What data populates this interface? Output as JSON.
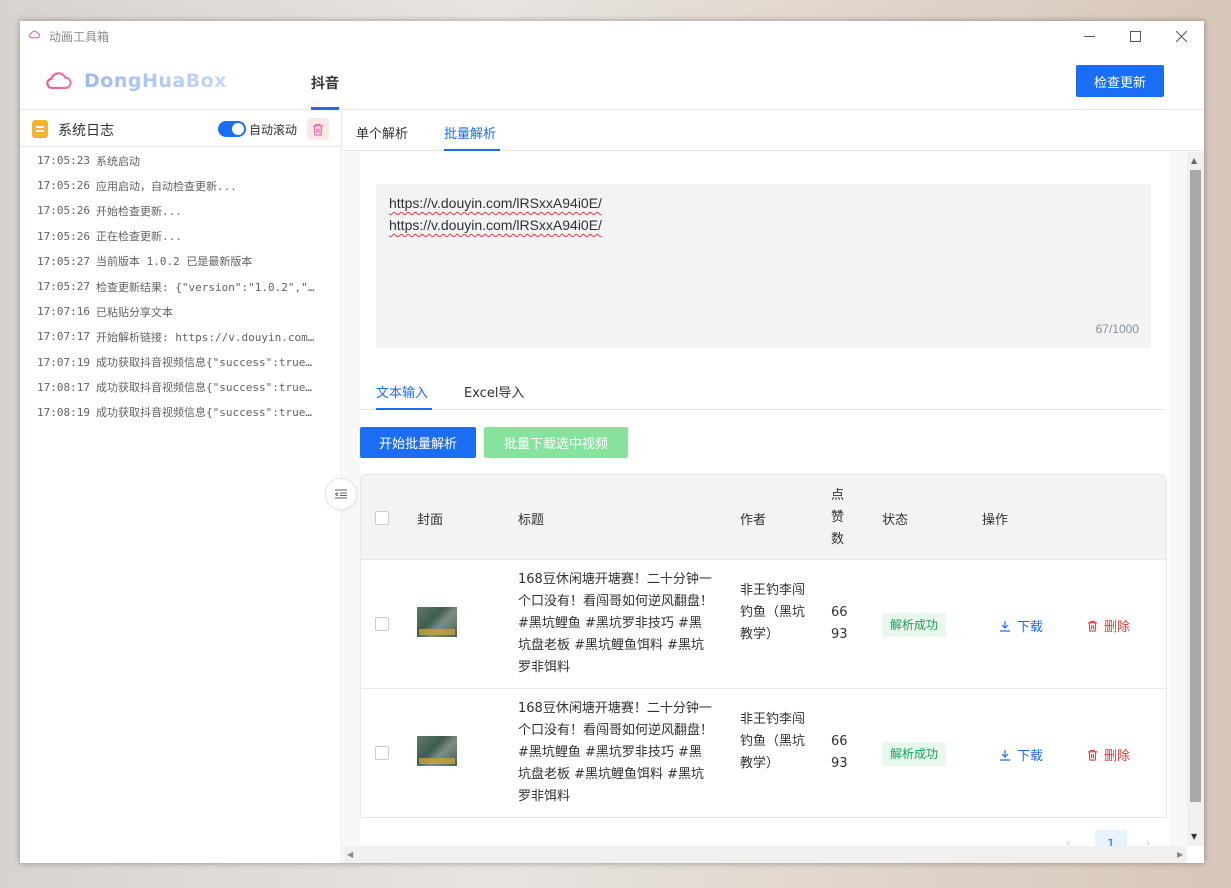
{
  "window": {
    "title": "动画工具箱"
  },
  "header": {
    "logo_text": "DongHuaBox",
    "nav_tab": "抖音",
    "update_button": "检查更新"
  },
  "sidebar": {
    "title": "系统日志",
    "auto_scroll_label": "自动滚动",
    "auto_scroll_on": true,
    "logs": [
      {
        "time": "17:05:23",
        "msg": "系统启动"
      },
      {
        "time": "17:05:26",
        "msg": "应用启动，自动检查更新..."
      },
      {
        "time": "17:05:26",
        "msg": "开始检查更新..."
      },
      {
        "time": "17:05:26",
        "msg": "正在检查更新..."
      },
      {
        "time": "17:05:27",
        "msg": "当前版本 1.0.2 已是最新版本"
      },
      {
        "time": "17:05:27",
        "msg": "检查更新结果: {\"version\":\"1.0.2\",\"f…"
      },
      {
        "time": "17:07:16",
        "msg": "已粘贴分享文本"
      },
      {
        "time": "17:07:17",
        "msg": "开始解析链接: https://v.douyin.com/…"
      },
      {
        "time": "17:07:19",
        "msg": "成功获取抖音视频信息{\"success\":true…"
      },
      {
        "time": "17:08:17",
        "msg": "成功获取抖音视频信息{\"success\":true…"
      },
      {
        "time": "17:08:19",
        "msg": "成功获取抖音视频信息{\"success\":true…"
      }
    ]
  },
  "main": {
    "tabs": [
      "单个解析",
      "批量解析"
    ],
    "active_tab": "批量解析",
    "textarea": {
      "lines": [
        "https://v.douyin.com/lRSxxA94i0E/",
        "https://v.douyin.com/lRSxxA94i0E/"
      ],
      "count": "67/1000"
    },
    "input_tabs": [
      "文本输入",
      "Excel导入"
    ],
    "start_button": "开始批量解析",
    "download_selected_button": "批量下载选中视频",
    "table": {
      "headers": {
        "cover": "封面",
        "title": "标题",
        "author": "作者",
        "likes": "点赞数",
        "status": "状态",
        "actions": "操作"
      },
      "rows": [
        {
          "title": "168豆休闲塘开塘赛！二十分钟一个口没有！看闯哥如何逆风翻盘！#黑坑鲤鱼 #黑坑罗非技巧 #黑坑盘老板 #黑坑鲤鱼饵料 #黑坑罗非饵料",
          "author": "非王钓李闯钓鱼（黑坑教学）",
          "likes": "6693",
          "status": "解析成功",
          "download": "下载",
          "delete": "删除"
        },
        {
          "title": "168豆休闲塘开塘赛！二十分钟一个口没有！看闯哥如何逆风翻盘！#黑坑鲤鱼 #黑坑罗非技巧 #黑坑盘老板 #黑坑鲤鱼饵料 #黑坑罗非饵料",
          "author": "非王钓李闯钓鱼（黑坑教学）",
          "likes": "6693",
          "status": "解析成功",
          "download": "下载",
          "delete": "删除"
        }
      ]
    },
    "pagination": {
      "current": "1"
    }
  },
  "colors": {
    "primary": "#1b6ef3",
    "success": "#18a058",
    "danger": "#e03b3b",
    "warning": "#f5b331"
  }
}
